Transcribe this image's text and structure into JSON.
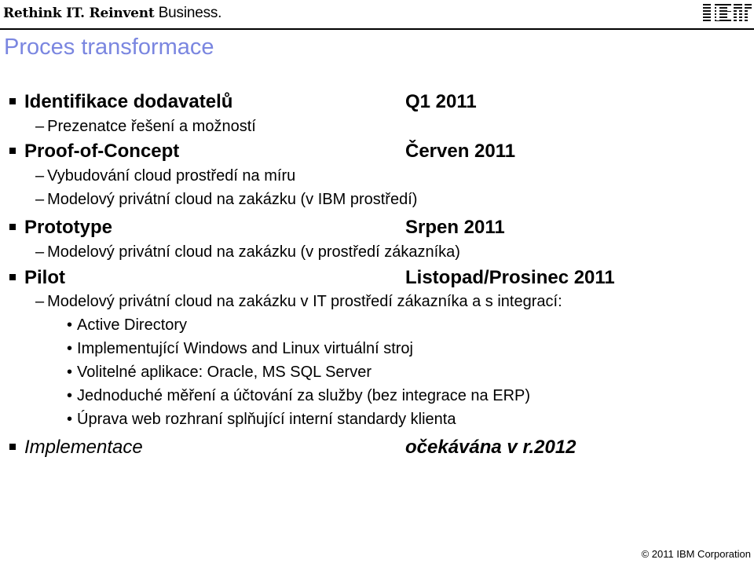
{
  "header": {
    "tagline_bold": "Rethink IT. Reinvent",
    "tagline_regular": "Business.",
    "logo": "IBM"
  },
  "title": "Proces transformace",
  "phases": [
    {
      "label": "Identifikace dodavatelů",
      "date": "Q1 2011",
      "subitems": [
        "Prezenatce řešení a možností"
      ]
    },
    {
      "label": "Proof-of-Concept",
      "date": "Červen 2011",
      "subitems": [
        "Vybudování cloud prostředí na míru",
        "Modelový privátní cloud na zakázku (v IBM prostředí)"
      ]
    },
    {
      "label": "Prototype",
      "date": "Srpen 2011",
      "subitems": [
        "Modelový privátní cloud na zakázku (v prostředí zákazníka)"
      ]
    },
    {
      "label": "Pilot",
      "date": "Listopad/Prosinec 2011",
      "subitems": [
        "Modelový privátní cloud na zakázku v IT prostředí zákazníka a s integrací:"
      ],
      "details": [
        "Active Directory",
        "Implementující Windows and Linux virtuální stroj",
        "Volitelné aplikace: Oracle, MS SQL Server",
        "Jednoduché měření a účtování za služby (bez integrace na ERP)",
        "Úprava web rozhraní splňující interní standardy klienta"
      ]
    },
    {
      "label": "Implementace",
      "date": "očekávána v r.2012"
    }
  ],
  "footer": {
    "copyright": "© 2011 IBM Corporation"
  },
  "colors": {
    "title": "#7a86e0"
  }
}
